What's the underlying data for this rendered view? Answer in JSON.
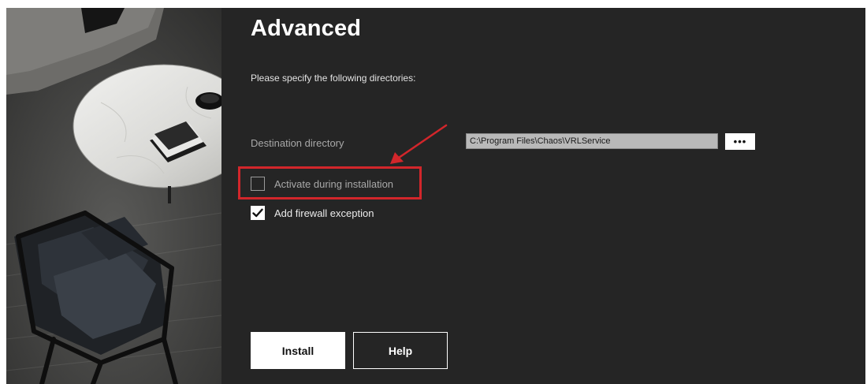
{
  "header": {
    "title": "Advanced",
    "subtitle": "Please specify the following directories:"
  },
  "destination": {
    "label": "Destination directory",
    "value": "C:\\Program Files\\Chaos\\VRLService",
    "browse_label": "•••"
  },
  "options": [
    {
      "label": "Activate during installation",
      "checked": false
    },
    {
      "label": "Add firewall exception",
      "checked": true
    }
  ],
  "buttons": {
    "install_label": "Install",
    "help_label": "Help"
  },
  "colors": {
    "background": "#252525",
    "annotation": "#d2262b",
    "field": "#b9b9b9"
  },
  "icons": {
    "checkmark": "checkmark-icon",
    "annotation_arrow": "red-arrow-icon"
  }
}
